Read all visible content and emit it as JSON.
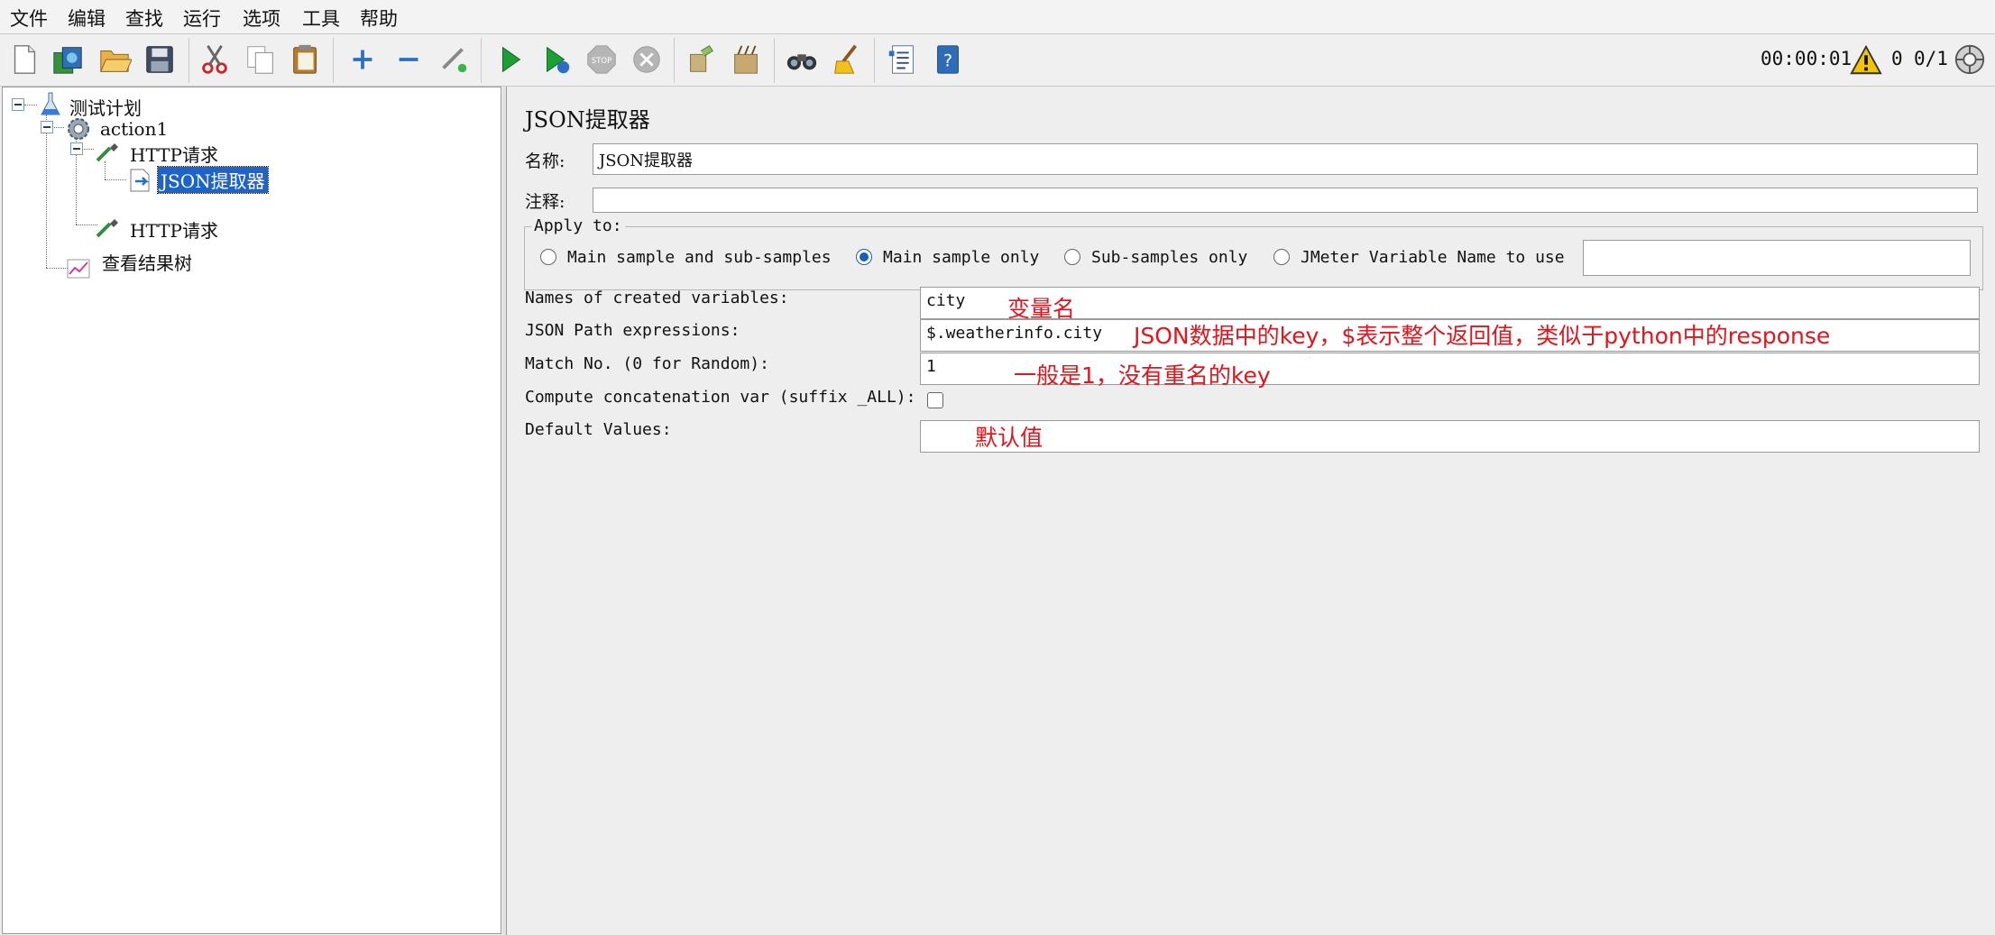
{
  "menu": [
    "文件",
    "编辑",
    "查找",
    "运行",
    "选项",
    "工具",
    "帮助"
  ],
  "toolbar": {
    "icons": [
      "new-icon",
      "templates-icon",
      "open-icon",
      "save-icon",
      "cut-icon",
      "copy-icon",
      "paste-icon",
      "expand-icon",
      "collapse-icon",
      "toggle-icon",
      "start-icon",
      "start-no-pause-icon",
      "stop-icon",
      "shutdown-icon",
      "clear-icon",
      "clear-all-icon",
      "search-icon",
      "reset-search-icon",
      "function-helper-icon",
      "help-icon"
    ],
    "timer": "00:00:01",
    "warning_count": "0",
    "threads": "0/1"
  },
  "tree": {
    "root": "测试计划",
    "thread_group": "action1",
    "http1": "HTTP请求",
    "extractor": "JSON提取器",
    "http2": "HTTP请求",
    "listener": "查看结果树"
  },
  "panel": {
    "title": "JSON提取器",
    "name_label": "名称:",
    "name_value": "JSON提取器",
    "comment_label": "注释:",
    "comment_value": "",
    "apply_to": {
      "legend": "Apply to:",
      "options": [
        "Main sample and sub-samples",
        "Main sample only",
        "Sub-samples only",
        "JMeter Variable Name to use"
      ],
      "selected": "Main sample only",
      "variable_value": ""
    },
    "fields": {
      "names_label": "Names of created variables:",
      "names_value": "city",
      "path_label": "JSON Path expressions:",
      "path_value": "$.weatherinfo.city",
      "match_label": "Match No. (0 for Random):",
      "match_value": "1",
      "concat_label": "Compute concatenation var (suffix _ALL):",
      "concat_checked": false,
      "default_label": "Default Values:",
      "default_value": ""
    }
  },
  "annotations": {
    "names": "变量名",
    "path": "JSON数据中的key，$表示整个返回值，类似于python中的response",
    "match": "一般是1，没有重名的key",
    "default": "默认值"
  },
  "colors": {
    "annotation": "#e3141b",
    "selection": "#1e64c8",
    "radio_selected": "#1560bd"
  }
}
